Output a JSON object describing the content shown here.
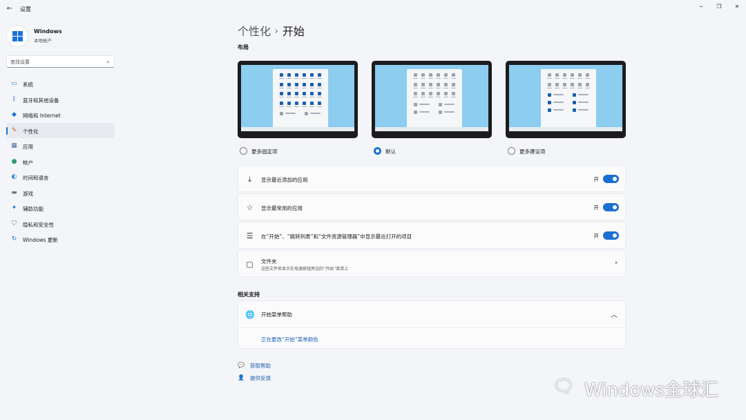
{
  "window": {
    "title": "设置",
    "back_icon": "arrow-left",
    "controls": [
      "minimize-icon",
      "restore-icon",
      "close-icon"
    ]
  },
  "account": {
    "name": "Windows",
    "type": "本地帐户"
  },
  "search": {
    "placeholder": "查找设置"
  },
  "sidebar": {
    "active_index": 3,
    "accent_color": "#1a6fd0",
    "items": [
      {
        "label": "系统",
        "icon": "monitor-icon"
      },
      {
        "label": "蓝牙和其他设备",
        "icon": "bluetooth-icon"
      },
      {
        "label": "网络和 Internet",
        "icon": "wifi-icon"
      },
      {
        "label": "个性化",
        "icon": "paintbrush-icon"
      },
      {
        "label": "应用",
        "icon": "apps-icon"
      },
      {
        "label": "帐户",
        "icon": "person-icon"
      },
      {
        "label": "时间和语言",
        "icon": "globe-clock-icon"
      },
      {
        "label": "游戏",
        "icon": "gamepad-icon"
      },
      {
        "label": "辅助功能",
        "icon": "accessibility-icon"
      },
      {
        "label": "隐私和安全性",
        "icon": "shield-icon"
      },
      {
        "label": "Windows 更新",
        "icon": "update-icon"
      }
    ]
  },
  "breadcrumb": {
    "parent": "个性化",
    "separator": "›",
    "current": "开始"
  },
  "layout_section": {
    "title": "布局",
    "selected_index": 1,
    "options": [
      {
        "label": "更多固定项",
        "pinned_rows": 4,
        "recommended_rows": 1
      },
      {
        "label": "默认",
        "pinned_rows": 3,
        "recommended_rows": 2
      },
      {
        "label": "更多建议项",
        "pinned_rows": 2,
        "recommended_rows": 3
      }
    ]
  },
  "settings": [
    {
      "label": "显示最近添加的应用",
      "icon": "download-icon",
      "state": "开",
      "on": true
    },
    {
      "label": "显示最常用的应用",
      "icon": "star-icon",
      "state": "开",
      "on": true
    },
    {
      "label": "在“开始”、“跳转列表”和“文件资源管理器”中显示最近打开的项目",
      "icon": "list-icon",
      "state": "开",
      "on": true
    },
    {
      "label": "文件夹",
      "sublabel": "这些文件夹显示在电源按钮旁边的“开始”菜单上",
      "icon": "folder-icon"
    }
  ],
  "related": {
    "title": "相关支持",
    "help_title": "开始菜单帮助",
    "help_icon": "globe-icon",
    "help_link": "正在更改“开始”菜单颜色"
  },
  "footer": {
    "get_help": "获取帮助",
    "feedback": "提供反馈"
  },
  "watermark": {
    "text": "Windows全球汇",
    "icon": "wechat-icon"
  }
}
